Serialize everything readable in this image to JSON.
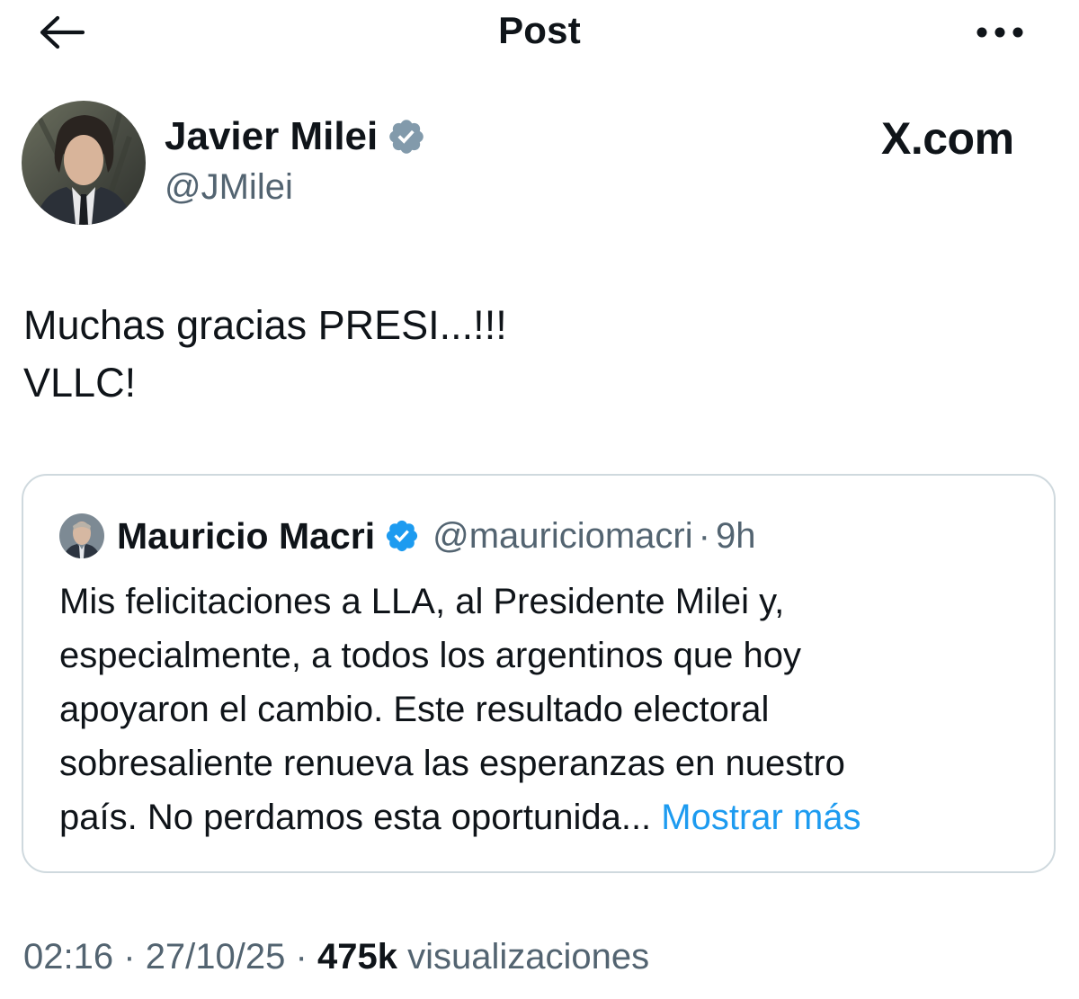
{
  "header": {
    "title": "Post"
  },
  "author": {
    "name": "Javier Milei",
    "handle": "@JMilei",
    "verified": true
  },
  "source_label": "X.com",
  "post": {
    "lines": [
      "Muchas gracias PRESI...!!!",
      "VLLC!"
    ]
  },
  "quote": {
    "name": "Mauricio Macri",
    "handle": "@mauriciomacri",
    "separator": "·",
    "time": "9h",
    "verified": true,
    "lines": [
      "Mis felicitaciones a LLA, al Presidente Milei y,",
      "especialmente, a todos los argentinos que hoy",
      "apoyaron el cambio. Este resultado electoral",
      "sobresaliente renueva las esperanzas en nuestro",
      "país. No perdamos esta oportunida..."
    ],
    "show_more": "Mostrar más"
  },
  "meta": {
    "time": "02:16",
    "sep1": "·",
    "date": "27/10/25",
    "sep2": "·",
    "views_count": "475k",
    "views_label": "visualizaciones"
  },
  "colors": {
    "text": "#0f1419",
    "secondary": "#536471",
    "link": "#1d9bf0",
    "border": "#cfd9de",
    "verified_blue": "#1d9bf0",
    "verified_gray": "#829aab"
  },
  "icons": {
    "back": "back-arrow-icon",
    "more": "more-horizontal-icon",
    "verified_author": "verified-badge-gray-icon",
    "verified_quote": "verified-badge-blue-icon"
  }
}
